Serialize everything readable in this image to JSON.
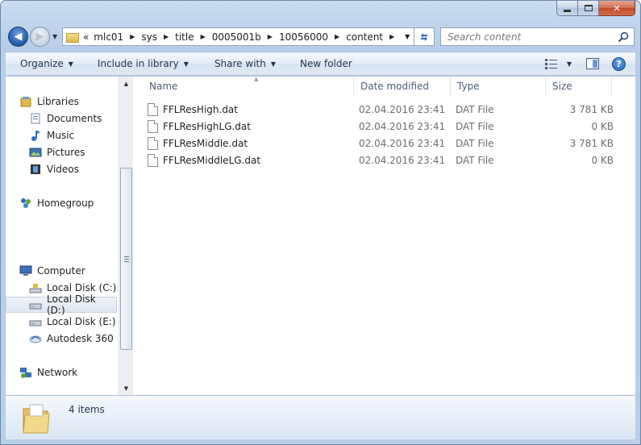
{
  "address": {
    "overflow": "«",
    "breadcrumbs": [
      "mlc01",
      "sys",
      "title",
      "0005001b",
      "10056000",
      "content"
    ]
  },
  "search": {
    "placeholder": "Search content"
  },
  "toolbar": {
    "organize": "Organize",
    "include_in_library": "Include in library",
    "share_with": "Share with",
    "new_folder": "New folder"
  },
  "nav": {
    "libraries": "Libraries",
    "documents": "Documents",
    "music": "Music",
    "pictures": "Pictures",
    "videos": "Videos",
    "homegroup": "Homegroup",
    "computer": "Computer",
    "disk_c": "Local Disk (C:)",
    "disk_d": "Local Disk (D:)",
    "disk_e": "Local Disk (E:)",
    "autodesk": "Autodesk 360",
    "network": "Network"
  },
  "columns": {
    "name": "Name",
    "date": "Date modified",
    "type": "Type",
    "size": "Size"
  },
  "files": [
    {
      "name": "FFLResHigh.dat",
      "date": "02.04.2016 23:41",
      "type": "DAT File",
      "size": "3 781 KB"
    },
    {
      "name": "FFLResHighLG.dat",
      "date": "02.04.2016 23:41",
      "type": "DAT File",
      "size": "0 KB"
    },
    {
      "name": "FFLResMiddle.dat",
      "date": "02.04.2016 23:41",
      "type": "DAT File",
      "size": "3 781 KB"
    },
    {
      "name": "FFLResMiddleLG.dat",
      "date": "02.04.2016 23:41",
      "type": "DAT File",
      "size": "0 KB"
    }
  ],
  "details": {
    "item_count": "4 items"
  },
  "colors": {
    "accent": "#3b6fb6",
    "frame": "#b9cfe9",
    "close": "#c3482a"
  }
}
